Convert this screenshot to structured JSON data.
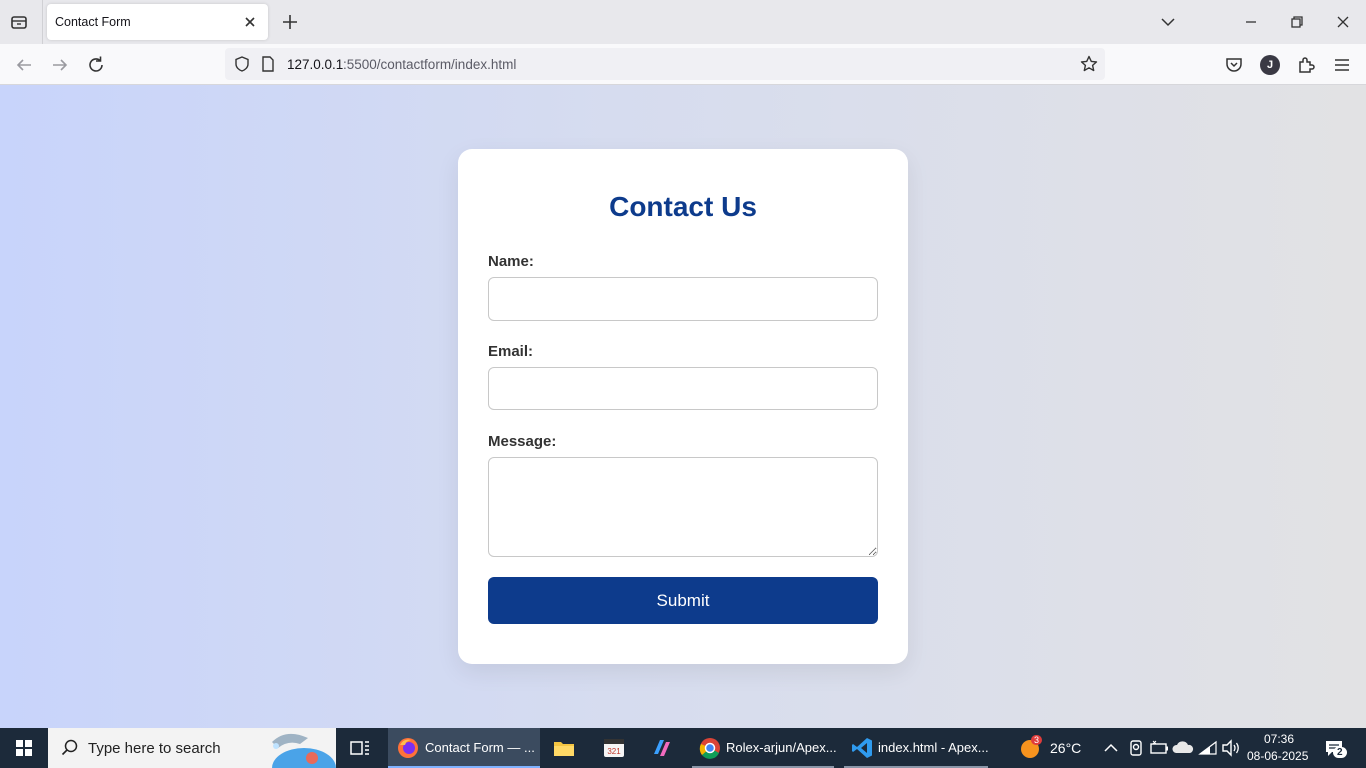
{
  "browser": {
    "tab_title": "Contact Form",
    "url_host": "127.0.0.1",
    "url_path": ":5500/contactform/index.html",
    "profile_initial": "J"
  },
  "form": {
    "heading": "Contact Us",
    "name_label": "Name:",
    "name_value": "",
    "email_label": "Email:",
    "email_value": "",
    "message_label": "Message:",
    "message_value": "",
    "submit_label": "Submit"
  },
  "taskbar": {
    "search_placeholder": "Type here to search",
    "apps": [
      {
        "label": "Contact Form — ...",
        "icon": "firefox-icon"
      },
      {
        "label": "Rolex-arjun/Apex...",
        "icon": "chrome-icon"
      },
      {
        "label": "index.html - Apex...",
        "icon": "vscode-icon"
      }
    ],
    "weather_badge": "3",
    "temperature": "26°C",
    "time": "07:36",
    "date": "08-06-2025",
    "notification_count": "2"
  },
  "colors": {
    "accent": "#0d3b8c",
    "bg_left": "#c8d4fb",
    "bg_right": "#e2e2e4",
    "taskbar": "#1c2a3a"
  }
}
